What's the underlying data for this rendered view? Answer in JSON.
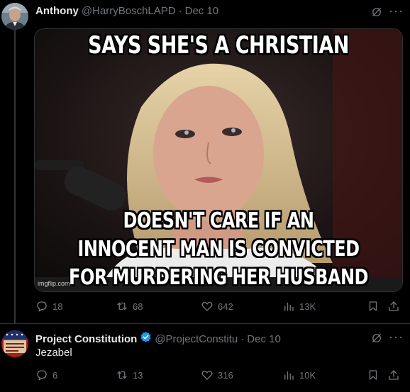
{
  "tweet1": {
    "display_name": "Anthony",
    "handle": "@HarryBoschLAPD",
    "separator": "·",
    "date": "Dec 10",
    "media": {
      "top_text": "SAYS SHE'S A CHRISTIAN",
      "bottom_text_line1": "DOESN'T CARE IF AN",
      "bottom_text_line2": "INNOCENT MAN IS CONVICTED",
      "bottom_text_line3": "FOR MURDERING HER HUSBAND",
      "watermark": "imgflip.com"
    },
    "actions": {
      "replies": "18",
      "reposts": "68",
      "likes": "642",
      "views": "13K"
    }
  },
  "tweet2": {
    "display_name": "Project Constitution",
    "handle": "@ProjectConstitu",
    "separator": "·",
    "date": "Dec 10",
    "text": "Jezabel",
    "actions": {
      "replies": "6",
      "reposts": "13",
      "likes": "316",
      "views": "10K"
    }
  },
  "colors": {
    "background": "#000000",
    "text_primary": "#e7e9ea",
    "text_secondary": "#71767b",
    "verified": "#1d9bf0",
    "divider": "#2f3336"
  }
}
